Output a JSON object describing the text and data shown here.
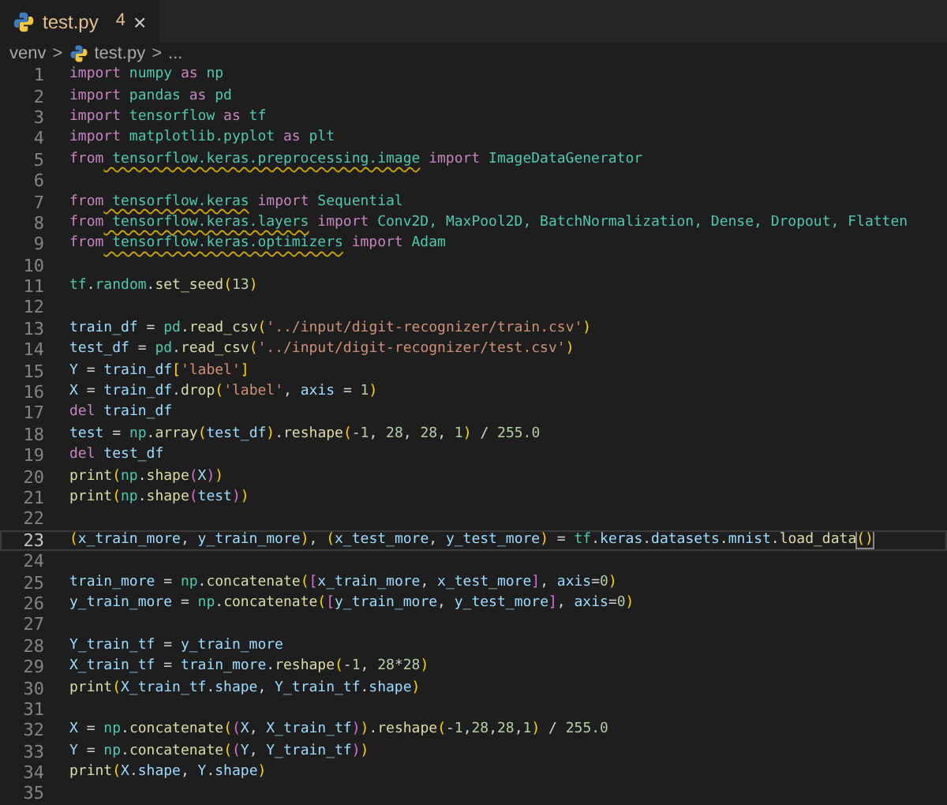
{
  "tab": {
    "filename": "test.py",
    "problems": "4",
    "close": "×",
    "selected": true,
    "warning": true
  },
  "breadcrumb": {
    "folder": "venv",
    "separator_1": ">",
    "file": "test.py",
    "separator_2": ">",
    "more": "..."
  },
  "lines": [
    {
      "number": "1",
      "current": false,
      "tokens": [
        {
          "kind": "kw",
          "text": "import"
        },
        {
          "kind": "mod",
          "text": " numpy"
        },
        {
          "kind": "kw",
          "text": " as"
        },
        {
          "kind": "mod",
          "text": " np"
        }
      ]
    },
    {
      "number": "2",
      "current": false,
      "tokens": [
        {
          "kind": "kw",
          "text": "import"
        },
        {
          "kind": "mod",
          "text": " pandas"
        },
        {
          "kind": "kw",
          "text": " as"
        },
        {
          "kind": "mod",
          "text": " pd"
        }
      ]
    },
    {
      "number": "3",
      "current": false,
      "tokens": [
        {
          "kind": "kw",
          "text": "import"
        },
        {
          "kind": "mod",
          "text": " tensorflow"
        },
        {
          "kind": "kw",
          "text": " as"
        },
        {
          "kind": "mod",
          "text": " tf"
        }
      ]
    },
    {
      "number": "4",
      "current": false,
      "tokens": [
        {
          "kind": "kw",
          "text": "import"
        },
        {
          "kind": "mod",
          "text": " matplotlib.pyplot"
        },
        {
          "kind": "kw",
          "text": " as"
        },
        {
          "kind": "mod",
          "text": " plt"
        }
      ]
    },
    {
      "number": "5",
      "current": false,
      "tokens": [
        {
          "kind": "kw",
          "text": "from"
        },
        {
          "kind": "mod",
          "text": " tensorflow.keras.preprocessing.image",
          "squiggle": true
        },
        {
          "kind": "kw",
          "text": " import"
        },
        {
          "kind": "mod",
          "text": " ImageDataGenerator"
        }
      ]
    },
    {
      "number": "6",
      "current": false
    },
    {
      "number": "7",
      "current": false,
      "tokens": [
        {
          "kind": "kw",
          "text": "from"
        },
        {
          "kind": "mod",
          "text": " tensorflow.keras",
          "squiggle": true
        },
        {
          "kind": "kw",
          "text": " import"
        },
        {
          "kind": "mod",
          "text": " Sequential"
        }
      ]
    },
    {
      "number": "8",
      "current": false,
      "tokens": [
        {
          "kind": "kw",
          "text": "from"
        },
        {
          "kind": "mod",
          "text": " tensorflow.keras.layers",
          "squiggle": true
        },
        {
          "kind": "kw",
          "text": " import"
        },
        {
          "kind": "mod",
          "text": " Conv2D, MaxPool2D, BatchNormalization, Dense, Dropout, Flatten"
        }
      ]
    },
    {
      "number": "9",
      "current": false,
      "tokens": [
        {
          "kind": "kw",
          "text": "from"
        },
        {
          "kind": "mod",
          "text": " tensorflow.keras.optimizers",
          "squiggle": true
        },
        {
          "kind": "kw",
          "text": " import"
        },
        {
          "kind": "mod",
          "text": " Adam"
        }
      ]
    },
    {
      "number": "10",
      "current": false
    },
    {
      "number": "11",
      "current": false,
      "tokens": [
        {
          "kind": "mod",
          "text": "tf"
        },
        {
          "kind": "p",
          "text": "."
        },
        {
          "kind": "mod",
          "text": "random"
        },
        {
          "kind": "p",
          "text": "."
        },
        {
          "kind": "fn",
          "text": "set_seed"
        },
        {
          "kind": "b1",
          "text": "("
        },
        {
          "kind": "num",
          "text": "13"
        },
        {
          "kind": "b1",
          "text": ")"
        }
      ]
    },
    {
      "number": "12",
      "current": false
    },
    {
      "number": "13",
      "current": false,
      "tokens": [
        {
          "kind": "var",
          "text": "train_df"
        },
        {
          "kind": "p",
          "text": " ="
        },
        {
          "kind": "mod",
          "text": " pd"
        },
        {
          "kind": "p",
          "text": "."
        },
        {
          "kind": "fn",
          "text": "read_csv"
        },
        {
          "kind": "b1",
          "text": "("
        },
        {
          "kind": "str",
          "text": "'../input/digit-recognizer/train.csv'"
        },
        {
          "kind": "b1",
          "text": ")"
        }
      ]
    },
    {
      "number": "14",
      "current": false,
      "tokens": [
        {
          "kind": "var",
          "text": "test_df"
        },
        {
          "kind": "p",
          "text": " ="
        },
        {
          "kind": "mod",
          "text": " pd"
        },
        {
          "kind": "p",
          "text": "."
        },
        {
          "kind": "fn",
          "text": "read_csv"
        },
        {
          "kind": "b1",
          "text": "("
        },
        {
          "kind": "str",
          "text": "'../input/digit-recognizer/test.csv'"
        },
        {
          "kind": "b1",
          "text": ")"
        }
      ]
    },
    {
      "number": "15",
      "current": false,
      "tokens": [
        {
          "kind": "var",
          "text": "Y"
        },
        {
          "kind": "p",
          "text": " ="
        },
        {
          "kind": "var",
          "text": " train_df"
        },
        {
          "kind": "b1",
          "text": "["
        },
        {
          "kind": "str",
          "text": "'label'"
        },
        {
          "kind": "b1",
          "text": "]"
        }
      ]
    },
    {
      "number": "16",
      "current": false,
      "tokens": [
        {
          "kind": "var",
          "text": "X"
        },
        {
          "kind": "p",
          "text": " ="
        },
        {
          "kind": "var",
          "text": " train_df"
        },
        {
          "kind": "p",
          "text": "."
        },
        {
          "kind": "fn",
          "text": "drop"
        },
        {
          "kind": "b1",
          "text": "("
        },
        {
          "kind": "str",
          "text": "'label'"
        },
        {
          "kind": "p",
          "text": ","
        },
        {
          "kind": "var",
          "text": " axis"
        },
        {
          "kind": "p",
          "text": " ="
        },
        {
          "kind": "num",
          "text": " 1"
        },
        {
          "kind": "b1",
          "text": ")"
        }
      ]
    },
    {
      "number": "17",
      "current": false,
      "tokens": [
        {
          "kind": "kw",
          "text": "del"
        },
        {
          "kind": "var",
          "text": " train_df"
        }
      ]
    },
    {
      "number": "18",
      "current": false,
      "tokens": [
        {
          "kind": "var",
          "text": "test"
        },
        {
          "kind": "p",
          "text": " ="
        },
        {
          "kind": "mod",
          "text": " np"
        },
        {
          "kind": "p",
          "text": "."
        },
        {
          "kind": "fn",
          "text": "array"
        },
        {
          "kind": "b1",
          "text": "("
        },
        {
          "kind": "var",
          "text": "test_df"
        },
        {
          "kind": "b1",
          "text": ")"
        },
        {
          "kind": "p",
          "text": "."
        },
        {
          "kind": "fn",
          "text": "reshape"
        },
        {
          "kind": "b1",
          "text": "("
        },
        {
          "kind": "p",
          "text": "-"
        },
        {
          "kind": "num",
          "text": "1"
        },
        {
          "kind": "p",
          "text": ","
        },
        {
          "kind": "num",
          "text": " 28"
        },
        {
          "kind": "p",
          "text": ","
        },
        {
          "kind": "num",
          "text": " 28"
        },
        {
          "kind": "p",
          "text": ","
        },
        {
          "kind": "num",
          "text": " 1"
        },
        {
          "kind": "b1",
          "text": ")"
        },
        {
          "kind": "p",
          "text": " /"
        },
        {
          "kind": "num",
          "text": " 255.0"
        }
      ]
    },
    {
      "number": "19",
      "current": false,
      "tokens": [
        {
          "kind": "kw",
          "text": "del"
        },
        {
          "kind": "var",
          "text": " test_df"
        }
      ]
    },
    {
      "number": "20",
      "current": false,
      "tokens": [
        {
          "kind": "fn",
          "text": "print"
        },
        {
          "kind": "b1",
          "text": "("
        },
        {
          "kind": "mod",
          "text": "np"
        },
        {
          "kind": "p",
          "text": "."
        },
        {
          "kind": "fn",
          "text": "shape"
        },
        {
          "kind": "b2",
          "text": "("
        },
        {
          "kind": "var",
          "text": "X"
        },
        {
          "kind": "b2",
          "text": ")"
        },
        {
          "kind": "b1",
          "text": ")"
        }
      ]
    },
    {
      "number": "21",
      "current": false,
      "tokens": [
        {
          "kind": "fn",
          "text": "print"
        },
        {
          "kind": "b1",
          "text": "("
        },
        {
          "kind": "mod",
          "text": "np"
        },
        {
          "kind": "p",
          "text": "."
        },
        {
          "kind": "fn",
          "text": "shape"
        },
        {
          "kind": "b2",
          "text": "("
        },
        {
          "kind": "var",
          "text": "test"
        },
        {
          "kind": "b2",
          "text": ")"
        },
        {
          "kind": "b1",
          "text": ")"
        }
      ]
    },
    {
      "number": "22",
      "current": false
    },
    {
      "number": "23",
      "current": true,
      "tokens": [
        {
          "kind": "b1",
          "text": "("
        },
        {
          "kind": "var",
          "text": "x_train_more"
        },
        {
          "kind": "p",
          "text": ","
        },
        {
          "kind": "var",
          "text": " y_train_more"
        },
        {
          "kind": "b1",
          "text": ")"
        },
        {
          "kind": "p",
          "text": ","
        },
        {
          "kind": "b1",
          "text": " ("
        },
        {
          "kind": "var",
          "text": "x_test_more"
        },
        {
          "kind": "p",
          "text": ","
        },
        {
          "kind": "var",
          "text": " y_test_more"
        },
        {
          "kind": "b1",
          "text": ")"
        },
        {
          "kind": "p",
          "text": " ="
        },
        {
          "kind": "mod",
          "text": " tf"
        },
        {
          "kind": "p",
          "text": "."
        },
        {
          "kind": "var",
          "text": "keras"
        },
        {
          "kind": "p",
          "text": "."
        },
        {
          "kind": "var",
          "text": "datasets"
        },
        {
          "kind": "p",
          "text": "."
        },
        {
          "kind": "var",
          "text": "mnist"
        },
        {
          "kind": "p",
          "text": "."
        },
        {
          "kind": "fn",
          "text": "load_data"
        },
        {
          "kind": "b1",
          "text": "()",
          "match": true
        }
      ]
    },
    {
      "number": "24",
      "current": false
    },
    {
      "number": "25",
      "current": false,
      "tokens": [
        {
          "kind": "var",
          "text": "train_more"
        },
        {
          "kind": "p",
          "text": " ="
        },
        {
          "kind": "mod",
          "text": " np"
        },
        {
          "kind": "p",
          "text": "."
        },
        {
          "kind": "fn",
          "text": "concatenate"
        },
        {
          "kind": "b1",
          "text": "("
        },
        {
          "kind": "b2",
          "text": "["
        },
        {
          "kind": "var",
          "text": "x_train_more"
        },
        {
          "kind": "p",
          "text": ","
        },
        {
          "kind": "var",
          "text": " x_test_more"
        },
        {
          "kind": "b2",
          "text": "]"
        },
        {
          "kind": "p",
          "text": ","
        },
        {
          "kind": "var",
          "text": " axis"
        },
        {
          "kind": "p",
          "text": "="
        },
        {
          "kind": "num",
          "text": "0"
        },
        {
          "kind": "b1",
          "text": ")"
        }
      ]
    },
    {
      "number": "26",
      "current": false,
      "tokens": [
        {
          "kind": "var",
          "text": "y_train_more"
        },
        {
          "kind": "p",
          "text": " ="
        },
        {
          "kind": "mod",
          "text": " np"
        },
        {
          "kind": "p",
          "text": "."
        },
        {
          "kind": "fn",
          "text": "concatenate"
        },
        {
          "kind": "b1",
          "text": "("
        },
        {
          "kind": "b2",
          "text": "["
        },
        {
          "kind": "var",
          "text": "y_train_more"
        },
        {
          "kind": "p",
          "text": ","
        },
        {
          "kind": "var",
          "text": " y_test_more"
        },
        {
          "kind": "b2",
          "text": "]"
        },
        {
          "kind": "p",
          "text": ","
        },
        {
          "kind": "var",
          "text": " axis"
        },
        {
          "kind": "p",
          "text": "="
        },
        {
          "kind": "num",
          "text": "0"
        },
        {
          "kind": "b1",
          "text": ")"
        }
      ]
    },
    {
      "number": "27",
      "current": false
    },
    {
      "number": "28",
      "current": false,
      "tokens": [
        {
          "kind": "var",
          "text": "Y_train_tf"
        },
        {
          "kind": "p",
          "text": " ="
        },
        {
          "kind": "var",
          "text": " y_train_more"
        }
      ]
    },
    {
      "number": "29",
      "current": false,
      "tokens": [
        {
          "kind": "var",
          "text": "X_train_tf"
        },
        {
          "kind": "p",
          "text": " ="
        },
        {
          "kind": "var",
          "text": " train_more"
        },
        {
          "kind": "p",
          "text": "."
        },
        {
          "kind": "fn",
          "text": "reshape"
        },
        {
          "kind": "b1",
          "text": "("
        },
        {
          "kind": "p",
          "text": "-"
        },
        {
          "kind": "num",
          "text": "1"
        },
        {
          "kind": "p",
          "text": ","
        },
        {
          "kind": "num",
          "text": " 28"
        },
        {
          "kind": "p",
          "text": "*"
        },
        {
          "kind": "num",
          "text": "28"
        },
        {
          "kind": "b1",
          "text": ")"
        }
      ]
    },
    {
      "number": "30",
      "current": false,
      "tokens": [
        {
          "kind": "fn",
          "text": "print"
        },
        {
          "kind": "b1",
          "text": "("
        },
        {
          "kind": "var",
          "text": "X_train_tf"
        },
        {
          "kind": "p",
          "text": "."
        },
        {
          "kind": "var",
          "text": "shape"
        },
        {
          "kind": "p",
          "text": ","
        },
        {
          "kind": "var",
          "text": " Y_train_tf"
        },
        {
          "kind": "p",
          "text": "."
        },
        {
          "kind": "var",
          "text": "shape"
        },
        {
          "kind": "b1",
          "text": ")"
        }
      ]
    },
    {
      "number": "31",
      "current": false
    },
    {
      "number": "32",
      "current": false,
      "tokens": [
        {
          "kind": "var",
          "text": "X"
        },
        {
          "kind": "p",
          "text": " ="
        },
        {
          "kind": "mod",
          "text": " np"
        },
        {
          "kind": "p",
          "text": "."
        },
        {
          "kind": "fn",
          "text": "concatenate"
        },
        {
          "kind": "b1",
          "text": "("
        },
        {
          "kind": "b2",
          "text": "("
        },
        {
          "kind": "var",
          "text": "X"
        },
        {
          "kind": "p",
          "text": ","
        },
        {
          "kind": "var",
          "text": " X_train_tf"
        },
        {
          "kind": "b2",
          "text": ")"
        },
        {
          "kind": "b1",
          "text": ")"
        },
        {
          "kind": "p",
          "text": "."
        },
        {
          "kind": "fn",
          "text": "reshape"
        },
        {
          "kind": "b1",
          "text": "("
        },
        {
          "kind": "p",
          "text": "-"
        },
        {
          "kind": "num",
          "text": "1"
        },
        {
          "kind": "p",
          "text": ","
        },
        {
          "kind": "num",
          "text": "28"
        },
        {
          "kind": "p",
          "text": ","
        },
        {
          "kind": "num",
          "text": "28"
        },
        {
          "kind": "p",
          "text": ","
        },
        {
          "kind": "num",
          "text": "1"
        },
        {
          "kind": "b1",
          "text": ")"
        },
        {
          "kind": "p",
          "text": " /"
        },
        {
          "kind": "num",
          "text": " 255.0"
        }
      ]
    },
    {
      "number": "33",
      "current": false,
      "tokens": [
        {
          "kind": "var",
          "text": "Y"
        },
        {
          "kind": "p",
          "text": " ="
        },
        {
          "kind": "mod",
          "text": " np"
        },
        {
          "kind": "p",
          "text": "."
        },
        {
          "kind": "fn",
          "text": "concatenate"
        },
        {
          "kind": "b1",
          "text": "("
        },
        {
          "kind": "b2",
          "text": "("
        },
        {
          "kind": "var",
          "text": "Y"
        },
        {
          "kind": "p",
          "text": ","
        },
        {
          "kind": "var",
          "text": " Y_train_tf"
        },
        {
          "kind": "b2",
          "text": ")"
        },
        {
          "kind": "b1",
          "text": ")"
        }
      ]
    },
    {
      "number": "34",
      "current": false,
      "tokens": [
        {
          "kind": "fn",
          "text": "print"
        },
        {
          "kind": "b1",
          "text": "("
        },
        {
          "kind": "var",
          "text": "X"
        },
        {
          "kind": "p",
          "text": "."
        },
        {
          "kind": "var",
          "text": "shape"
        },
        {
          "kind": "p",
          "text": ","
        },
        {
          "kind": "var",
          "text": " Y"
        },
        {
          "kind": "p",
          "text": "."
        },
        {
          "kind": "var",
          "text": "shape"
        },
        {
          "kind": "b1",
          "text": ")"
        }
      ]
    },
    {
      "number": "35",
      "current": false
    }
  ]
}
